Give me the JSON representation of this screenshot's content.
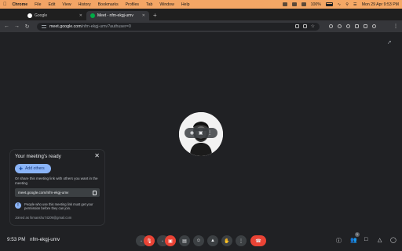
{
  "menubar": {
    "apple": "",
    "items": [
      "Chrome",
      "File",
      "Edit",
      "View",
      "History",
      "Bookmarks",
      "Profiles",
      "Tab",
      "Window",
      "Help"
    ],
    "battery": "100%",
    "datetime": "Mon 29 Apr  9:53 PM"
  },
  "tabs": [
    {
      "title": "Google",
      "favicon_color": "#ffffff",
      "active": false
    },
    {
      "title": "Meet - nfm-ekgj-umv",
      "favicon_color": "#00ac47",
      "active": true
    }
  ],
  "toolbar": {
    "url_host": "meet.google.com",
    "url_path": "/nfm-ekgj-umv?authuser=0",
    "menu": "⋮"
  },
  "meeting_card": {
    "title": "Your meeting's ready",
    "add_others_label": "Add others",
    "share_text": "Or share this meeting link with others you want in the meeting",
    "link": "meet.google.com/nfm-ekgj-umv",
    "info_text": "People who use this meeting link must get your permission before they can join.",
    "joined_as": "Joined as himanshu74209@gmail.com"
  },
  "bottom": {
    "time": "9:53 PM",
    "separator": "|",
    "meeting_code": "nfm-ekgj-umv",
    "people_count": "1"
  },
  "colors": {
    "accent": "#8ab4f8",
    "danger": "#ea4335",
    "background": "#202124"
  }
}
